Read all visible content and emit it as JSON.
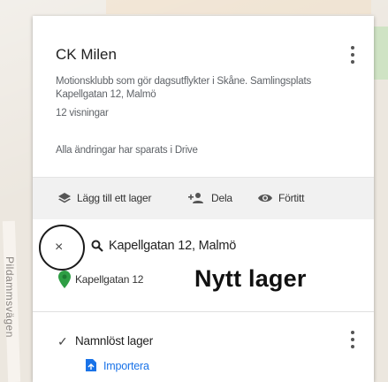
{
  "map": {
    "street_label": "Pildammsvägen"
  },
  "panel": {
    "title": "CK Milen",
    "description": "Motionsklubb som gör dagsutflykter i Skåne. Samlingsplats Kapellgatan 12, Malmö",
    "views": "12 visningar",
    "saved_status": "Alla ändringar har sparats i Drive"
  },
  "toolbar": {
    "add_layer_label": "Lägg till ett lager",
    "share_label": "Dela",
    "preview_label": "Förtitt"
  },
  "search": {
    "query": "Kapellgatan 12, Malmö",
    "close_symbol": "×"
  },
  "result": {
    "pin_label": "Kapellgatan 12",
    "annotation": "Nytt lager"
  },
  "layer": {
    "name": "Namnlöst lager",
    "import_label": "Importera"
  },
  "colors": {
    "accent": "#1a73e8",
    "pin": "#2e9e44",
    "toolbar_bg": "#f1f1f1"
  }
}
